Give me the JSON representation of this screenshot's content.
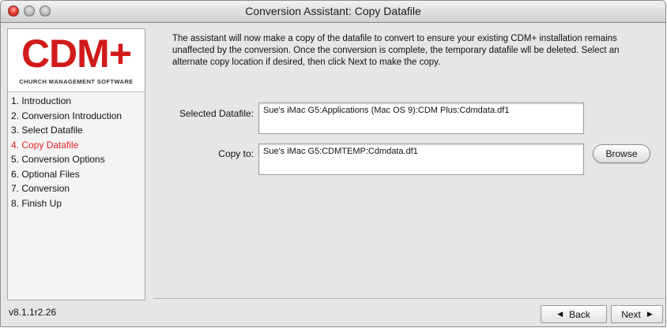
{
  "window": {
    "title": "Conversion Assistant: Copy Datafile"
  },
  "logo": {
    "text": "CDM+",
    "subtitle": "CHURCH MANAGEMENT SOFTWARE"
  },
  "sidebar": {
    "steps": [
      {
        "label": "1. Introduction",
        "active": false
      },
      {
        "label": "2. Conversion Introduction",
        "active": false
      },
      {
        "label": "3. Select Datafile",
        "active": false
      },
      {
        "label": "4. Copy Datafile",
        "active": true
      },
      {
        "label": "5. Conversion Options",
        "active": false
      },
      {
        "label": "6. Optional Files",
        "active": false
      },
      {
        "label": "7. Conversion",
        "active": false
      },
      {
        "label": "8. Finish Up",
        "active": false
      }
    ],
    "active_color": "#e02222"
  },
  "main": {
    "intro": "The assistant will now make a copy of the datafile to convert to ensure your existing CDM+ installation remains unaffected by the conversion. Once the conversion is complete, the temporary datafile wll be deleted. Select an alternate copy location if desired, then click Next to make the copy.",
    "selected_label": "Selected Datafile:",
    "selected_value": "Sue's iMac G5:Applications (Mac OS 9):CDM Plus:Cdmdata.df1",
    "copy_label": "Copy to:",
    "copy_value": "Sue's iMac G5:CDMTEMP:Cdmdata.df1",
    "browse_label": "Browse"
  },
  "footer": {
    "version": "v8.1.1r2.26",
    "back_label": "Back",
    "next_label": "Next"
  },
  "icons": {
    "back": "left-triangle-icon",
    "next": "right-triangle-icon"
  }
}
